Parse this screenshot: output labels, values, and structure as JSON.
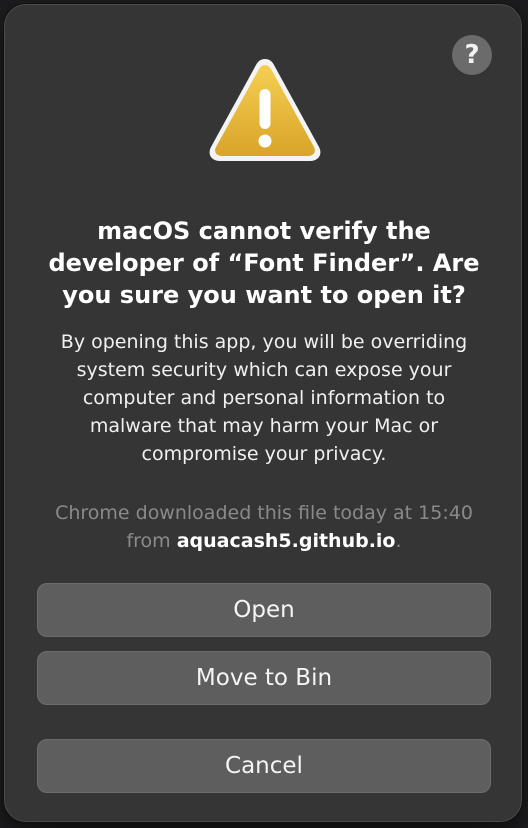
{
  "dialog": {
    "help_label": "?",
    "title": "macOS cannot verify the developer of “Font Finder”. Are you sure you want to open it?",
    "message": "By opening this app, you will be overriding system security which can expose your computer and personal information to malware that may harm your Mac or compromise your privacy.",
    "source_prefix": "Chrome downloaded this file today at 15:40 from ",
    "source_domain": "aquacash5.github.io",
    "source_suffix": ".",
    "buttons": {
      "open": "Open",
      "move_to_bin": "Move to Bin",
      "cancel": "Cancel"
    },
    "icon": "warning-triangle-icon"
  },
  "colors": {
    "dialog_bg": "#353535",
    "button_bg": "#5e5e5e",
    "warning_yellow": "#e9b93a",
    "muted_text": "#8a8a8a"
  }
}
